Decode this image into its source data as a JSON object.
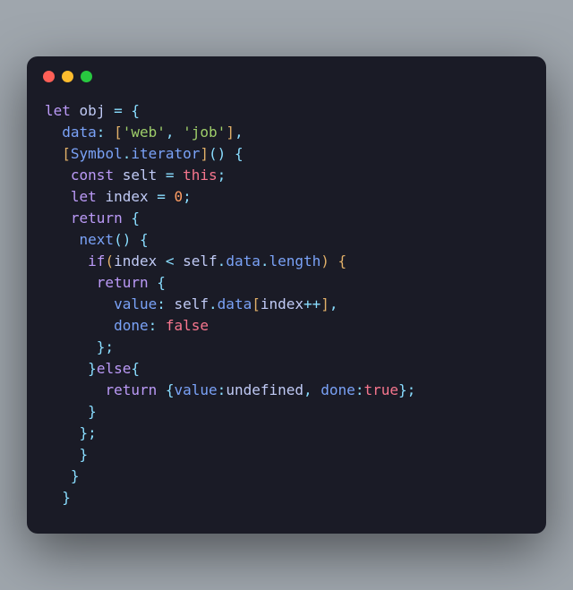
{
  "code": {
    "l1_let": "let",
    "l1_obj": "obj",
    "l1_eq": " = ",
    "l1_brace": "{",
    "l2_data": "data",
    "l2_colon": ": ",
    "l2_lb": "[",
    "l2_str1": "'web'",
    "l2_comma": ", ",
    "l2_str2": "'job'",
    "l2_rb": "]",
    "l2_end": ",",
    "l3_lb": "[",
    "l3_sym": "Symbol",
    "l3_dot": ".",
    "l3_iter": "iterator",
    "l3_rb": "]",
    "l3_p": "() {",
    "l4_const": "const",
    "l4_selt": " selt ",
    "l4_eq": "= ",
    "l4_this": "this",
    "l4_semi": ";",
    "l5_let": "let",
    "l5_index": " index ",
    "l5_eq": "= ",
    "l5_zero": "0",
    "l5_semi": ";",
    "l6_return": "return",
    "l6_brace": " {",
    "l7_next": "next",
    "l7_p": "() {",
    "l8_if": "if",
    "l8_lp": "(",
    "l8_index": "index ",
    "l8_lt": "< ",
    "l8_self": "self",
    "l8_dot1": ".",
    "l8_data": "data",
    "l8_dot2": ".",
    "l8_length": "length",
    "l8_rp": ") {",
    "l9_return": "return",
    "l9_brace": " {",
    "l10_value": "value",
    "l10_colon": ": ",
    "l10_self": "self",
    "l10_dot": ".",
    "l10_data": "data",
    "l10_lb": "[",
    "l10_index": "index",
    "l10_pp": "++",
    "l10_rb": "]",
    "l10_comma": ",",
    "l11_done": "done",
    "l11_colon": ": ",
    "l11_false": "false",
    "l12_close": "};",
    "l13_close": "}",
    "l13_else": "else",
    "l13_open": "{",
    "l14_return": "return",
    "l14_brace": " {",
    "l14_value": "value",
    "l14_colon1": ":",
    "l14_undef": "undefined",
    "l14_comma": ", ",
    "l14_done": "done",
    "l14_colon2": ":",
    "l14_true": "true",
    "l14_end": "};",
    "l15_close": "}",
    "l16_close": "};",
    "l17_close": "}",
    "l18_close": "}",
    "l19_close": "}"
  }
}
